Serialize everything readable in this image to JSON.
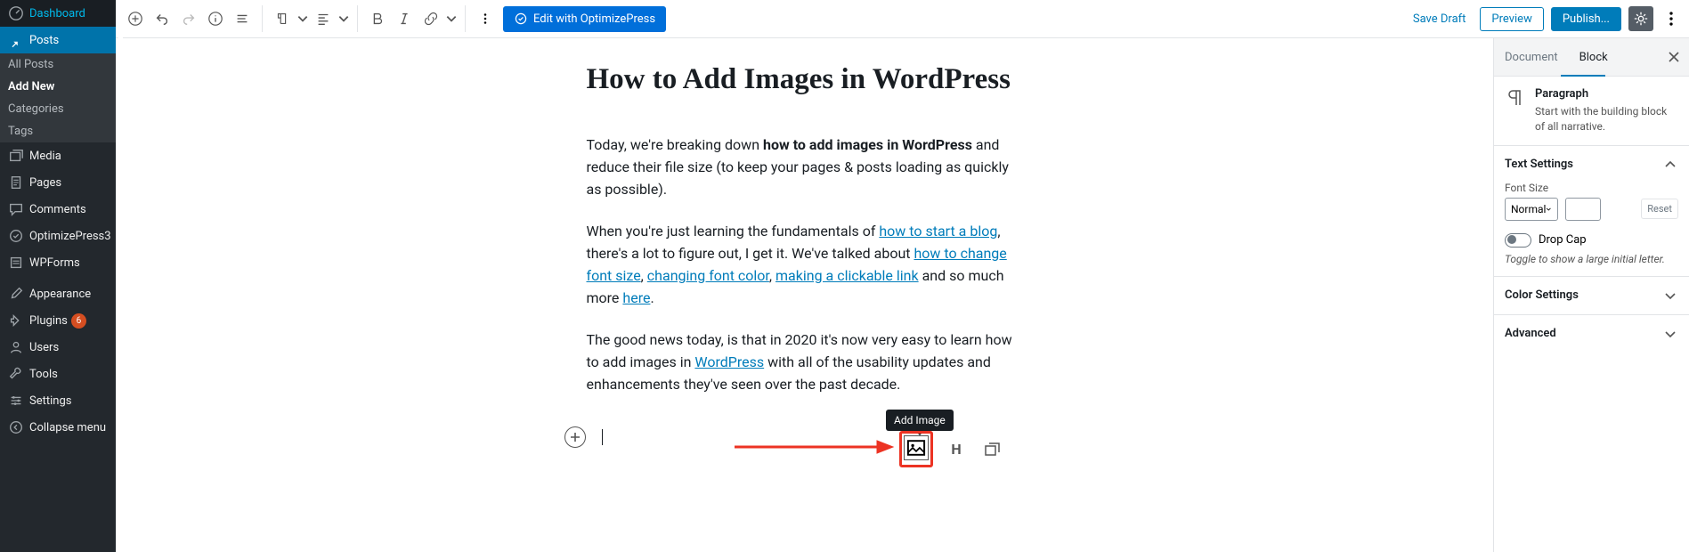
{
  "sidebar": {
    "dashboard": "Dashboard",
    "posts": "Posts",
    "sub": {
      "all": "All Posts",
      "addnew": "Add New",
      "categories": "Categories",
      "tags": "Tags"
    },
    "media": "Media",
    "pages": "Pages",
    "comments": "Comments",
    "optimizepress": "OptimizePress3",
    "wpforms": "WPForms",
    "appearance": "Appearance",
    "plugins": "Plugins",
    "plugins_badge": "6",
    "users": "Users",
    "tools": "Tools",
    "settings": "Settings",
    "collapse": "Collapse menu"
  },
  "toolbar": {
    "edit_op": "Edit with OptimizePress",
    "save_draft": "Save Draft",
    "preview": "Preview",
    "publish": "Publish..."
  },
  "content": {
    "title": "How to Add Images in WordPress",
    "p1_a": "Today, we're breaking down ",
    "p1_b": "how to add images in WordPress",
    "p1_c": " and reduce their file size (to keep your pages & posts loading as quickly as possible).",
    "p2_a": "When you're just learning the fundamentals of ",
    "p2_link1": "how to start a blog",
    "p2_b": ", there's a lot to figure out, I get it. We've talked about ",
    "p2_link2": "how to change font size",
    "p2_c": ", ",
    "p2_link3": "changing font color",
    "p2_d": ", ",
    "p2_link4": "making a clickable link",
    "p2_e": " and so much more ",
    "p2_link5": "here",
    "p2_f": ".",
    "p3_a": "The good news today, is that in 2020 it's now very easy to learn how to add images in ",
    "p3_link1": "WordPress",
    "p3_b": " with all of the usability updates and enhancements they've seen over the past decade."
  },
  "tooltip": "Add Image",
  "quick_h": "H",
  "panel": {
    "tab_document": "Document",
    "tab_block": "Block",
    "block_title": "Paragraph",
    "block_desc": "Start with the building block of all narrative.",
    "text_settings": "Text Settings",
    "font_size": "Font Size",
    "font_size_value": "Normal",
    "reset": "Reset",
    "drop_cap": "Drop Cap",
    "drop_cap_hint": "Toggle to show a large initial letter.",
    "color_settings": "Color Settings",
    "advanced": "Advanced"
  }
}
